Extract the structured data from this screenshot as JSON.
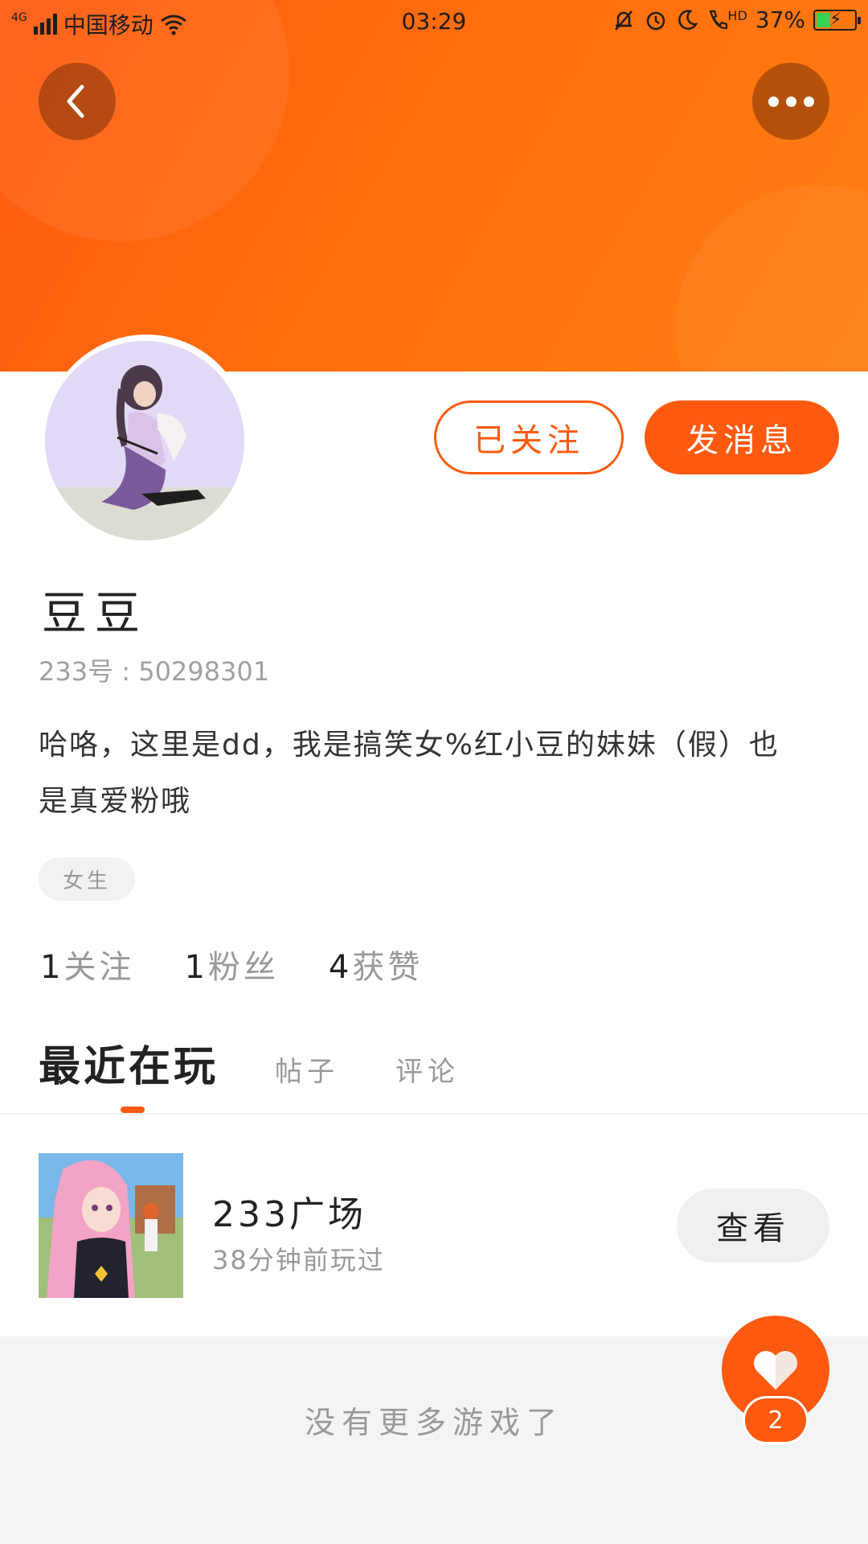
{
  "status_bar": {
    "network_type": "4G",
    "carrier": "中国移动",
    "time": "03:29",
    "hd_label": "HD",
    "battery_percent": "37%",
    "battery_level": 0.37,
    "icons": [
      "signal-icon",
      "wifi-icon",
      "mute-bell-icon",
      "alarm-icon",
      "moon-icon",
      "hd-call-icon",
      "battery-charging-icon"
    ]
  },
  "header": {
    "back_icon": "chevron-left-icon",
    "more_icon": "more-dots-icon",
    "accent_color": "#ff5a10"
  },
  "profile": {
    "followed_label": "已关注",
    "message_label": "发消息",
    "username": "豆豆",
    "user_id": "233号 : 50298301",
    "bio": "哈咯，这里是dd，我是搞笑女%红小豆的妹妹（假）也是真爱粉哦",
    "gender_tag": "女生",
    "stats": [
      {
        "num": "1",
        "label": "关注"
      },
      {
        "num": "1",
        "label": "粉丝"
      },
      {
        "num": "4",
        "label": "获赞"
      }
    ]
  },
  "tabs": [
    {
      "label": "最近在玩",
      "active": true
    },
    {
      "label": "帖子",
      "active": false
    },
    {
      "label": "评论",
      "active": false
    }
  ],
  "games": [
    {
      "name": "233广场",
      "time": "38分钟前玩过",
      "action": "查看"
    }
  ],
  "footer": {
    "no_more": "没有更多游戏了"
  },
  "like_fab": {
    "icon": "heart-icon",
    "count": "2"
  }
}
